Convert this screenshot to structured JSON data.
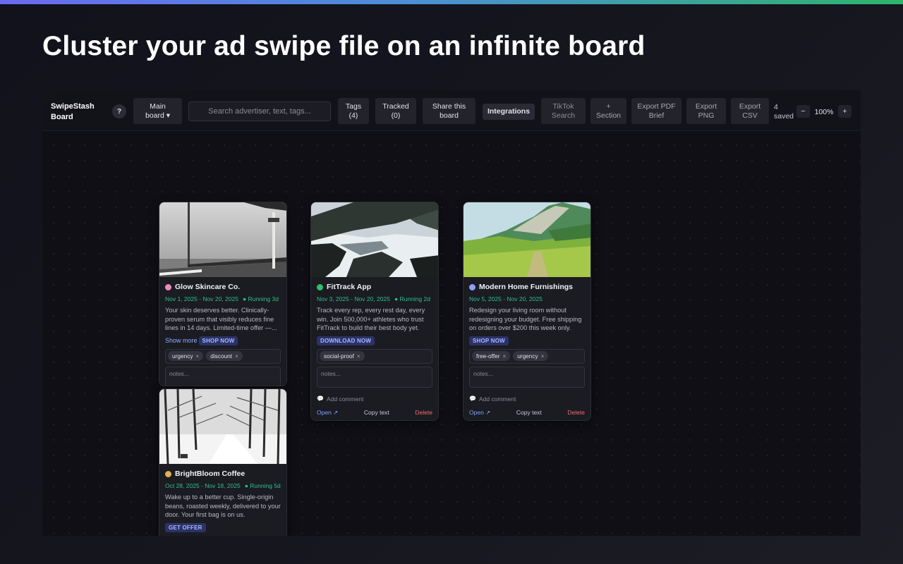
{
  "hero_title": "Cluster your ad swipe file on an infinite board",
  "toolbar": {
    "brand": "SwipeStash\nBoard",
    "help": "?",
    "board_select": "Main\nboard ▾",
    "search_placeholder": "Search advertiser, text, tags...",
    "tags": "Tags\n(4)",
    "tracked": "Tracked\n(0)",
    "share": "Share this\nboard",
    "integrations": "Integrations",
    "tiktok": "TikTok\nSearch",
    "section": "+\nSection",
    "export_pdf": "Export PDF\nBrief",
    "export_png": "Export\nPNG",
    "export_csv": "Export\nCSV",
    "saved": "4\nsaved",
    "zoom_out": "−",
    "zoom": "100%",
    "zoom_in": "+"
  },
  "cards": [
    {
      "advertiser": "Glow Skincare Co.",
      "dot_color": "#f08ab4",
      "dates": "Nov 1, 2025 - Nov 20, 2025",
      "running": "● Running 3d",
      "copy": "Your skin deserves better. Clinically-proven serum that visibly reduces fine lines in 14 days. Limited-time offer —...",
      "show_more": "Show more",
      "cta": "SHOP NOW",
      "tags": [
        "urgency",
        "discount"
      ],
      "notes_placeholder": "notes...",
      "image": "pier-icon"
    },
    {
      "advertiser": "FitTrack App",
      "dot_color": "#2fbf6a",
      "dates": "Nov 3, 2025 - Nov 20, 2025",
      "running": "● Running 2d",
      "copy": "Track every rep, every rest day, every win. Join 500,000+ athletes who trust FitTrack to build their best body yet.",
      "cta": "DOWNLOAD NOW",
      "tags": [
        "social-proof"
      ],
      "notes_placeholder": "notes...",
      "comment": "Add comment",
      "actions": {
        "open": "Open ↗",
        "copy": "Copy text",
        "delete": "Delete"
      },
      "image": "coast-rocks-icon"
    },
    {
      "advertiser": "Modern Home Furnishings",
      "dot_color": "#8ea0ff",
      "dates": "Nov 5, 2025 - Nov 20, 2025",
      "copy": "Redesign your living room without redesigning your budget. Free shipping on orders over $200 this week only.",
      "cta": "SHOP NOW",
      "tags": [
        "free-offer",
        "urgency"
      ],
      "notes_placeholder": "notes...",
      "comment": "Add comment",
      "actions": {
        "open": "Open ↗",
        "copy": "Copy text",
        "delete": "Delete"
      },
      "image": "mountain-meadow-icon"
    },
    {
      "advertiser": "BrightBloom Coffee",
      "dot_color": "#e0b050",
      "dates": "Oct 28, 2025 - Nov 18, 2025",
      "running": "● Running 5d",
      "copy": "Wake up to a better cup. Single-origin beans, roasted weekly, delivered to your door. Your first bag is on us.",
      "cta": "GET OFFER",
      "image": "snowy-path-icon"
    }
  ],
  "comment_icon": "speech-bubble-icon"
}
